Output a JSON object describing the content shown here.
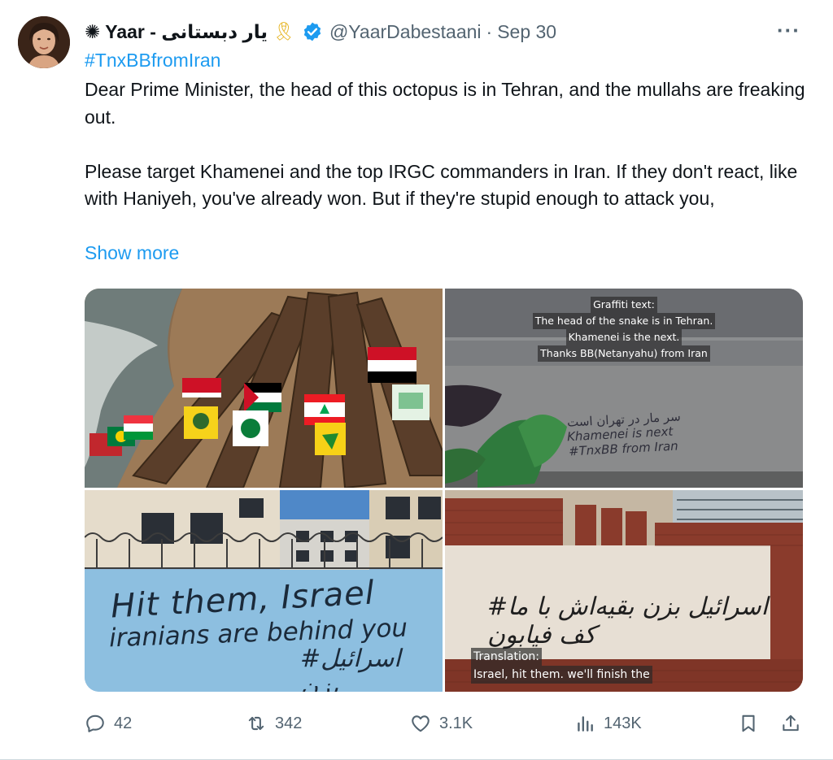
{
  "tweet": {
    "display_name": "Yaar - یار دبستانی",
    "name_prefix_glyph": "✺",
    "ribbon_emoji": "🎗",
    "verified_icon": "verified-badge-icon",
    "handle": "@YaarDabestaani",
    "separator": "·",
    "time": "Sep 30",
    "more_label": "···",
    "hashtag": "#TnxBBfromIran",
    "paragraph1": "Dear Prime Minister, the head of this octopus is in Tehran, and the mullahs are freaking out.",
    "paragraph2": "Please target Khamenei and the top IRGC commanders in Iran. If they don't react, like with Haniyeh, you've already won. But if they're stupid enough to attack you,",
    "show_more": "Show more"
  },
  "media": {
    "image2": {
      "caption_lines": [
        "Graffiti text:",
        "The head of the snake is in Tehran.",
        "Khamenei is the next.",
        "Thanks BB(Netanyahu) from Iran"
      ],
      "graffiti_lines": [
        "سر مار در تهران است",
        "Khamenei is next",
        "#TnxBB from Iran"
      ]
    },
    "image3": {
      "graffiti_lines": [
        "Hit them, Israel",
        "iranians are behind you",
        "#اسرائیل بزن"
      ]
    },
    "image4": {
      "graffiti": "#اسرائیل بزن بقیه‌اش با ما کف فیابون",
      "caption_lines": [
        "Translation:",
        "Israel, hit them. we'll finish the"
      ]
    }
  },
  "actions": {
    "reply_count": "42",
    "retweet_count": "342",
    "like_count": "3.1K",
    "views_count": "143K"
  },
  "colors": {
    "accent": "#1d9bf0",
    "muted": "#536471",
    "text": "#0f1419"
  }
}
